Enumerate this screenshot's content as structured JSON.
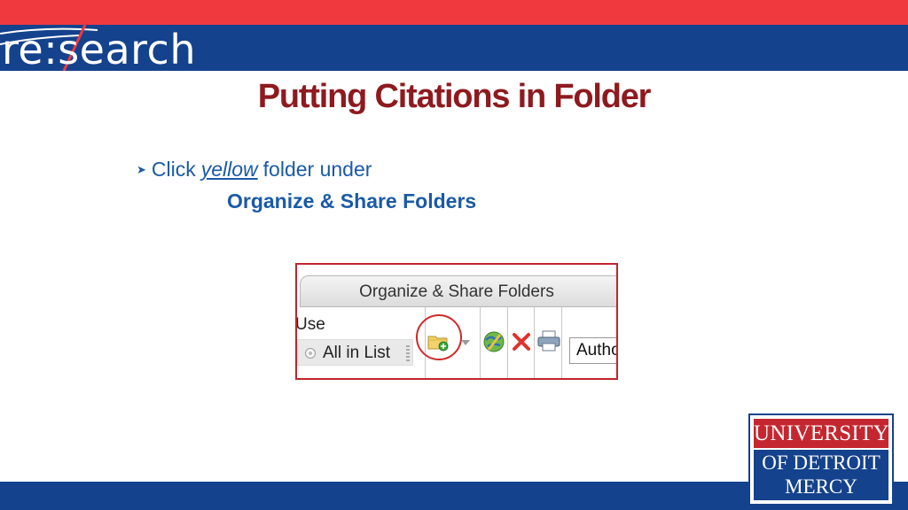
{
  "header": {
    "brand_logo_text": "re:search",
    "colors": {
      "red_band": "#f0393f",
      "blue_band": "#14428c"
    }
  },
  "slide": {
    "title": "Putting Citations in Folder",
    "title_color": "#8e1a1f",
    "bullet": {
      "prefix": "Click",
      "emphasis": "yellow",
      "suffix": "folder under"
    },
    "subline": "Organize & Share Folders",
    "text_color": "#1a5aa6"
  },
  "screenshot": {
    "header_label": "Organize & Share Folders",
    "use_label": "Use",
    "all_in_list_label": "All in List",
    "sort_select_value": "Autho",
    "icons": [
      "radio-icon",
      "grip-icon",
      "add-folder-icon",
      "dropdown-arrow-icon",
      "share-globe-icon",
      "delete-x-icon",
      "print-icon"
    ],
    "highlight_color": "#d02a2a"
  },
  "footer_logo": {
    "line1": "UNIVERSITY",
    "line2": "OF DETROIT",
    "line3": "MERCY",
    "colors": {
      "red": "#c52730",
      "blue": "#14428c"
    }
  }
}
